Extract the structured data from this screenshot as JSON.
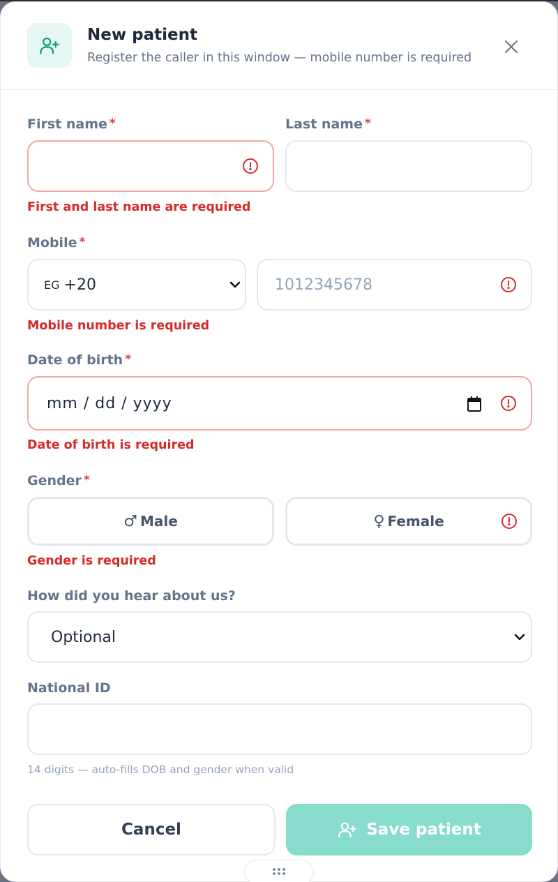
{
  "header": {
    "icon": "user-plus-icon",
    "title": "New patient",
    "subtitle": "Register the caller in this window — mobile number is required",
    "close_icon": "close-icon"
  },
  "form": {
    "required_mark": "*",
    "first_name": {
      "label": "First name",
      "value": "",
      "error": "First and last name are required"
    },
    "last_name": {
      "label": "Last name",
      "value": ""
    },
    "mobile": {
      "label": "Mobile",
      "country_code": "EG",
      "dial_code": "+20",
      "placeholder": "1012345678",
      "error": "Mobile number is required"
    },
    "dob": {
      "label": "Date of birth",
      "placeholder": "mm / dd / yyyy",
      "error": "Date of birth is required"
    },
    "gender": {
      "label": "Gender",
      "options": [
        {
          "symbol": "♂",
          "label": "Male"
        },
        {
          "symbol": "♀",
          "label": "Female"
        }
      ],
      "error": "Gender is required"
    },
    "referral": {
      "label": "How did you hear about us?",
      "selected": "Optional"
    },
    "national_id": {
      "label": "National ID",
      "value": "",
      "hint": "14 digits — auto-fills DOB and gender when valid"
    }
  },
  "actions": {
    "cancel_label": "Cancel",
    "save_label": "Save patient"
  },
  "colors": {
    "accent": "#0f9b7f",
    "save_disabled": "#87dccc",
    "error": "#d62b2b",
    "error_border": "#f2a6a6"
  }
}
